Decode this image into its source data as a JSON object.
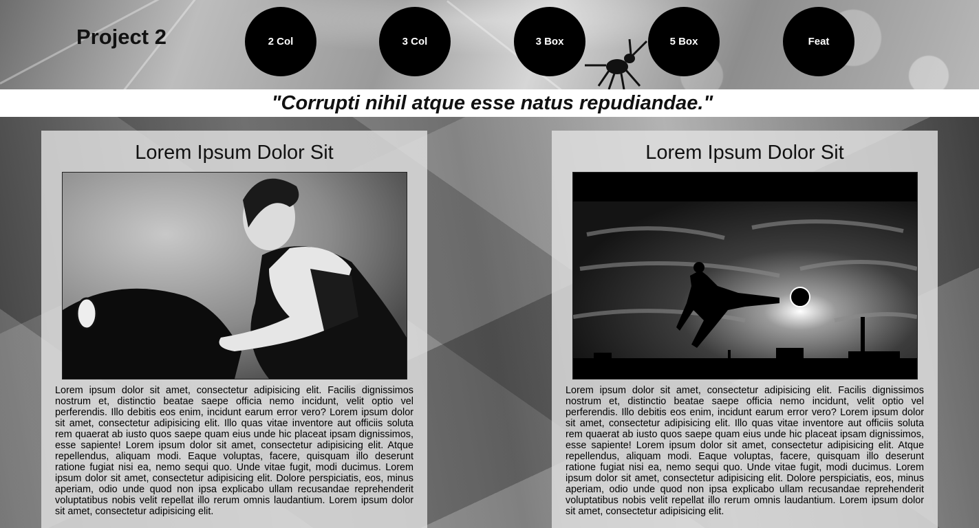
{
  "header": {
    "site_title": "Project 2",
    "nav": [
      {
        "label": "2 Col"
      },
      {
        "label": "3 Col"
      },
      {
        "label": "3 Box"
      },
      {
        "label": "5 Box"
      },
      {
        "label": "Feat"
      }
    ]
  },
  "quote": "\"Corrupti nihil atque esse natus repudiandae.\"",
  "cards": [
    {
      "title": "Lorem Ipsum Dolor Sit",
      "image": "portrait-woman-photo",
      "text": "Lorem ipsum dolor sit amet, consectetur adipisicing elit. Facilis dignissimos nostrum et, distinctio beatae saepe officia nemo incidunt, velit optio vel perferendis. Illo debitis eos enim, incidunt earum error vero? Lorem ipsum dolor sit amet, consectetur adipisicing elit. Illo quas vitae inventore aut officiis soluta rem quaerat ab iusto quos saepe quam eius unde hic placeat ipsam dignissimos, esse sapiente! Lorem ipsum dolor sit amet, consectetur adipisicing elit. Atque repellendus, aliquam modi. Eaque voluptas, facere, quisquam illo deserunt ratione fugiat nisi ea, nemo sequi quo. Unde vitae fugit, modi ducimus. Lorem ipsum dolor sit amet, consectetur adipisicing elit. Dolore perspiciatis, eos, minus aperiam, odio unde quod non ipsa explicabo ullam recusandae reprehenderit voluptatibus nobis velit repellat illo rerum omnis laudantium. Lorem ipsum dolor sit amet, consectetur adipisicing elit."
    },
    {
      "title": "Lorem Ipsum Dolor Sit",
      "image": "soccer-kick-silhouette-photo",
      "text": "Lorem ipsum dolor sit amet, consectetur adipisicing elit. Facilis dignissimos nostrum et, distinctio beatae saepe officia nemo incidunt, velit optio vel perferendis. Illo debitis eos enim, incidunt earum error vero? Lorem ipsum dolor sit amet, consectetur adipisicing elit. Illo quas vitae inventore aut officiis soluta rem quaerat ab iusto quos saepe quam eius unde hic placeat ipsam dignissimos, esse sapiente! Lorem ipsum dolor sit amet, consectetur adipisicing elit. Atque repellendus, aliquam modi. Eaque voluptas, facere, quisquam illo deserunt ratione fugiat nisi ea, nemo sequi quo. Unde vitae fugit, modi ducimus. Lorem ipsum dolor sit amet, consectetur adipisicing elit. Dolore perspiciatis, eos, minus aperiam, odio unde quod non ipsa explicabo ullam recusandae reprehenderit voluptatibus nobis velit repellat illo rerum omnis laudantium. Lorem ipsum dolor sit amet, consectetur adipisicing elit."
    }
  ]
}
